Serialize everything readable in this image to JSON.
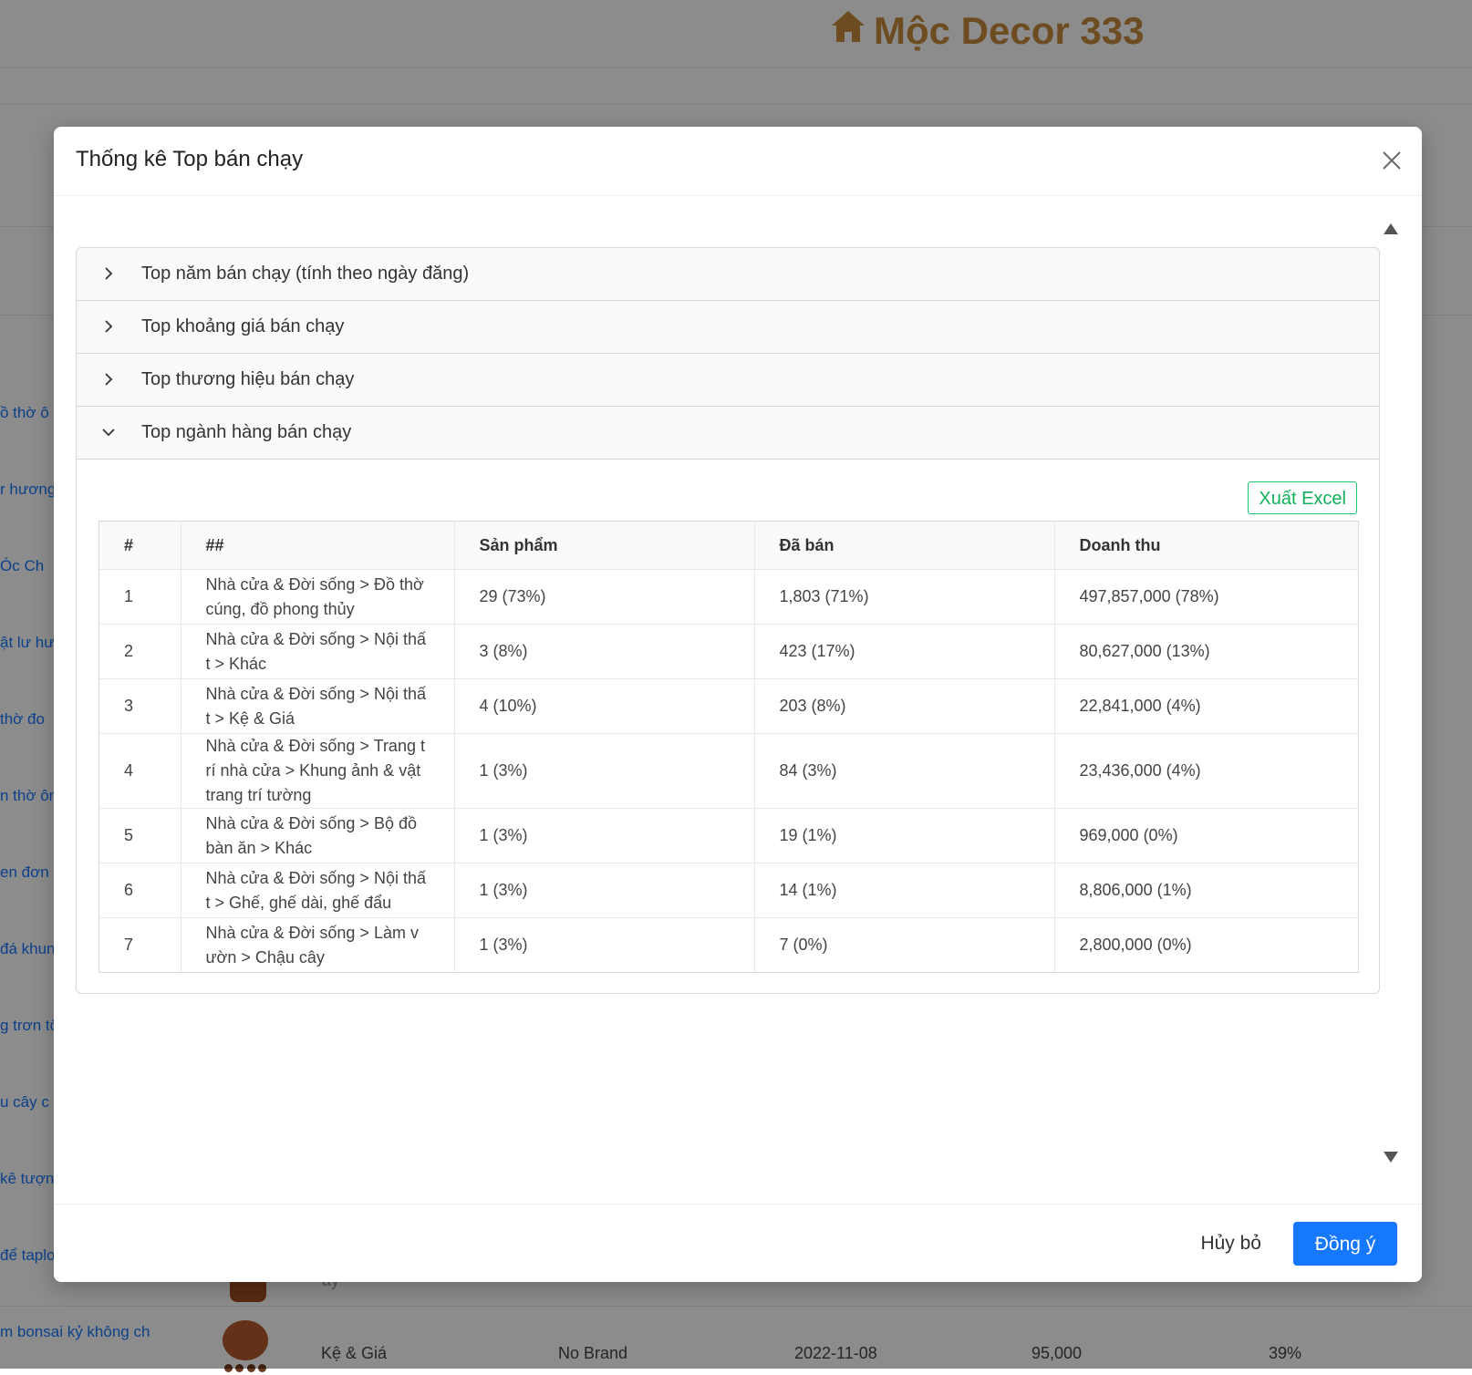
{
  "background": {
    "brand": "Mộc Decor 333",
    "left_items": [
      "ồ thờ ô",
      "r hương",
      "Óc Ch",
      "ật lư hư",
      "thờ đo",
      "n thờ ôn",
      "en đơn h",
      "đá khun",
      "g trơn tổ",
      "u cây c",
      "kê tượn",
      "để taplo",
      "m bonsai kỷ không ch"
    ],
    "partial_row_text": "ay",
    "last_row": {
      "category": "Kệ & Giá",
      "brand": "No Brand",
      "date": "2022-11-08",
      "price": "95,000",
      "percent": "39%"
    }
  },
  "modal": {
    "title": "Thống kê Top bán chạy",
    "panels": [
      {
        "label": "Top năm bán chạy (tính theo ngày đăng)",
        "expanded": false
      },
      {
        "label": "Top khoảng giá bán chạy",
        "expanded": false
      },
      {
        "label": "Top thương hiệu bán chạy",
        "expanded": false
      },
      {
        "label": "Top ngành hàng bán chạy",
        "expanded": true
      }
    ],
    "export_label": "Xuất Excel",
    "table": {
      "columns": [
        "#",
        "##",
        "Sản phẩm",
        "Đã bán",
        "Doanh thu"
      ],
      "rows": [
        {
          "rank": "1",
          "category": "Nhà cửa & Đời sống > Đồ thờ cúng, đồ phong thủy",
          "products": "29 (73%)",
          "sold": "1,803 (71%)",
          "revenue": "497,857,000 (78%)"
        },
        {
          "rank": "2",
          "category": "Nhà cửa & Đời sống > Nội thất > Khác",
          "products": "3 (8%)",
          "sold": "423 (17%)",
          "revenue": "80,627,000 (13%)"
        },
        {
          "rank": "3",
          "category": "Nhà cửa & Đời sống > Nội thất > Kệ & Giá",
          "products": "4 (10%)",
          "sold": "203 (8%)",
          "revenue": "22,841,000 (4%)"
        },
        {
          "rank": "4",
          "category": "Nhà cửa & Đời sống > Trang trí nhà cửa > Khung ảnh & vật trang trí tường",
          "products": "1 (3%)",
          "sold": "84 (3%)",
          "revenue": "23,436,000 (4%)"
        },
        {
          "rank": "5",
          "category": "Nhà cửa & Đời sống > Bộ đồ bàn ăn > Khác",
          "products": "1 (3%)",
          "sold": "19 (1%)",
          "revenue": "969,000 (0%)"
        },
        {
          "rank": "6",
          "category": "Nhà cửa & Đời sống > Nội thất > Ghế, ghế dài, ghế đẩu",
          "products": "1 (3%)",
          "sold": "14 (1%)",
          "revenue": "8,806,000 (1%)"
        },
        {
          "rank": "7",
          "category": "Nhà cửa & Đời sống > Làm vườn > Chậu cây",
          "products": "1 (3%)",
          "sold": "7 (0%)",
          "revenue": "2,800,000 (0%)"
        }
      ]
    },
    "cancel_label": "Hủy bỏ",
    "ok_label": "Đồng ý"
  },
  "colors": {
    "brand": "#c98b3c",
    "primary": "#1677ff",
    "excel": "#10b05a",
    "overlay": "rgba(0,0,0,0.45)"
  },
  "icons": {
    "brand": "home-icon",
    "close": "close-icon",
    "collapsed": "chevron-right-icon",
    "expanded": "chevron-down-icon",
    "scroll_up": "scroll-up-arrow-icon",
    "scroll_down": "scroll-down-arrow-icon"
  }
}
